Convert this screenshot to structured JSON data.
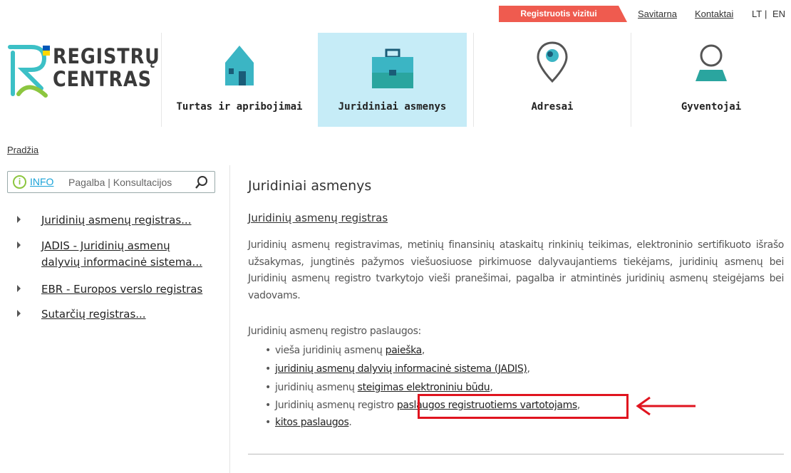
{
  "topbar": {
    "register_visit": "Registruotis vizitui",
    "self_service": "Savitarna",
    "contacts": "Kontaktai",
    "lang_lt": "LT",
    "lang_sep": "|",
    "lang_en": "EN"
  },
  "logo": {
    "line1": "REGISTRŲ",
    "line2": "CENTRAS"
  },
  "nav": [
    {
      "label": "Turtas ir apribojimai",
      "icon": "house-icon",
      "active": false
    },
    {
      "label": "Juridiniai asmenys",
      "icon": "briefcase-icon",
      "active": true
    },
    {
      "label": "Adresai",
      "icon": "map-pin-icon",
      "active": false
    },
    {
      "label": "Gyventojai",
      "icon": "person-icon",
      "active": false
    }
  ],
  "breadcrumb": "Pradžia",
  "info": {
    "word": "INFO",
    "help": "Pagalba | Konsultacijos"
  },
  "sidebar": {
    "items": [
      {
        "label": "Juridinių asmenų registras..."
      },
      {
        "label_line1": "JADIS - Juridinių asmenų",
        "label_line2": "dalyvių informacinė sistema..."
      },
      {
        "label": "EBR - Europos verslo registras"
      },
      {
        "label": "Sutarčių registras..."
      }
    ]
  },
  "main": {
    "title": "Juridiniai asmenys",
    "subtitle": "Juridinių asmenų registras",
    "paragraph": "Juridinių asmenų registravimas, metinių finansinių ataskaitų rinkinių teikimas, elektroninio sertifikuoto išrašo užsakymas, jungtinės pažymos viešuosiuose pirkimuose dalyvaujantiems tiekėjams, juridinių asmenų bei Juridinių asmenų registro tvarkytojo vieši pranešimai, pagalba ir atmintinės juridinių asmenų steigėjams bei vadovams.",
    "services_intro": "Juridinių asmenų registro paslaugos:",
    "services": [
      {
        "prefix": "vieša juridinių asmenų ",
        "link": "paieška",
        "suffix": ","
      },
      {
        "prefix": "",
        "link": "juridinių asmenų dalyvių informacinė sistema (JADIS)",
        "suffix": ","
      },
      {
        "prefix": "juridinių asmenų ",
        "link": "steigimas elektroniniu būdu",
        "suffix": ","
      },
      {
        "prefix": "Juridinių asmenų registro ",
        "link": "paslaugos registruotiems vartotojams",
        "suffix": ","
      },
      {
        "prefix": "",
        "link": "kitos paslaugos",
        "suffix": "."
      }
    ],
    "bullet": "•"
  },
  "colors": {
    "accent_red": "#ef5b4f",
    "active_tile": "#c6ecf7",
    "teal": "#2fb5b0",
    "highlight": "#e0141f"
  }
}
